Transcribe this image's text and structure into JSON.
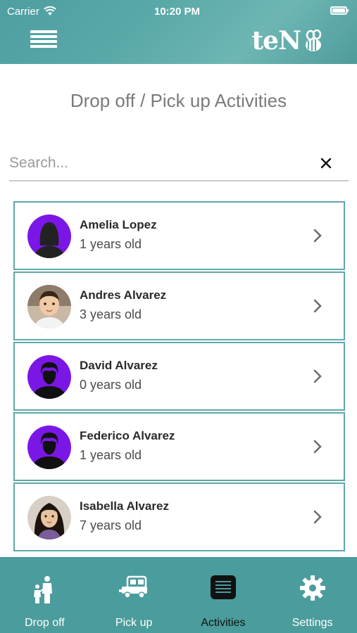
{
  "status_bar": {
    "carrier": "Carrier",
    "time": "10:20 PM"
  },
  "header": {
    "brand": "teN",
    "menu_icon": "hamburger-icon"
  },
  "page": {
    "title": "Drop off / Pick up Activities"
  },
  "search": {
    "placeholder": "Search...",
    "value": ""
  },
  "children": [
    {
      "name": "Amelia Lopez",
      "age": "1 years old",
      "avatar": "silhouette-female"
    },
    {
      "name": "Andres Alvarez",
      "age": "3 years old",
      "avatar": "photo"
    },
    {
      "name": "David Alvarez",
      "age": "0 years old",
      "avatar": "silhouette-male"
    },
    {
      "name": "Federico Alvarez",
      "age": "1 years old",
      "avatar": "silhouette-male"
    },
    {
      "name": "Isabella Alvarez",
      "age": "7 years old",
      "avatar": "photo"
    }
  ],
  "tabs": [
    {
      "label": "Drop off",
      "icon": "family-icon",
      "active": false
    },
    {
      "label": "Pick up",
      "icon": "car-icon",
      "active": false
    },
    {
      "label": "Activities",
      "icon": "list-icon",
      "active": true
    },
    {
      "label": "Settings",
      "icon": "gear-icon",
      "active": false
    }
  ],
  "colors": {
    "header": "#5aa9a9",
    "tabbar": "#4b9c9c",
    "row_border": "#5ea8a8",
    "avatar_purple": "#7a17e6"
  }
}
